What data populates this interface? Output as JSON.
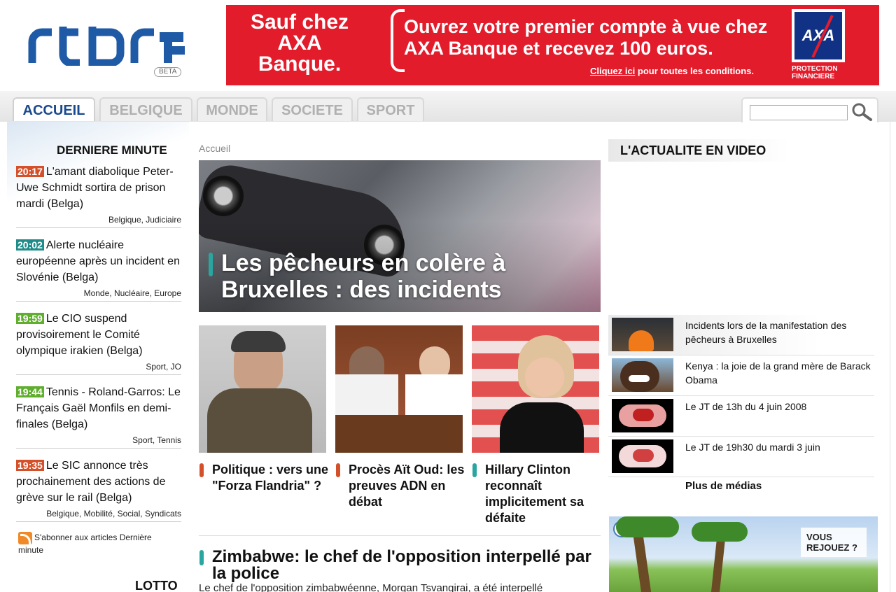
{
  "header": {
    "logo_text": "rtbf",
    "beta_label": "BETA"
  },
  "banner": {
    "left_text": "Sauf chez AXA Banque.",
    "main_text": "Ouvrez votre premier compte à vue chez AXA Banque et recevez 100 euros.",
    "cond_link": "Cliquez ici",
    "cond_rest": " pour toutes les conditions.",
    "brand": "AXA",
    "brand_sub": "PROTECTION FINANCIERE"
  },
  "nav": {
    "tabs": [
      {
        "label": "ACCUEIL",
        "active": true
      },
      {
        "label": "BELGIQUE",
        "active": false
      },
      {
        "label": "MONDE",
        "active": false
      },
      {
        "label": "SOCIETE",
        "active": false
      },
      {
        "label": "SPORT",
        "active": false
      }
    ],
    "search_placeholder": ""
  },
  "left": {
    "heading": "DERNIERE MINUTE",
    "items": [
      {
        "time": "20:17",
        "time_color": "#d4502a",
        "text": "L'amant diabolique Peter-Uwe Schmidt sortira de prison mardi (Belga)",
        "tags": "Belgique, Judiciaire"
      },
      {
        "time": "20:02",
        "time_color": "#1f8c8a",
        "text": "Alerte nucléaire européenne après un incident en Slovénie (Belga)",
        "tags": "Monde, Nucléaire, Europe"
      },
      {
        "time": "19:59",
        "time_color": "#5fae2e",
        "text": "Le CIO suspend provisoirement le Comité olympique irakien (Belga)",
        "tags": "Sport, JO"
      },
      {
        "time": "19:44",
        "time_color": "#5fae2e",
        "text": "Tennis - Roland-Garros: Le Français Gaël Monfils en demi-finales (Belga)",
        "tags": "Sport, Tennis"
      },
      {
        "time": "19:35",
        "time_color": "#d4502a",
        "text": "Le SIC annonce très prochainement des actions de grève sur le rail (Belga)",
        "tags": "Belgique, Mobilité, Social, Syndicats"
      }
    ],
    "rss_text": "S'abonner aux articles Dernière minute",
    "lotto_heading": "LOTTO"
  },
  "center": {
    "breadcrumb": "Accueil",
    "hero_title": "Les pêcheurs en colère à Bruxelles : des incidents",
    "stories": [
      {
        "title": "Politique : vers une \"Forza Flandria\" ?",
        "mark_color": "#d4502a"
      },
      {
        "title": "Procès Aït Oud: les preuves ADN en débat",
        "mark_color": "#d4502a"
      },
      {
        "title": "Hillary Clinton reconnaît implicitement sa défaite",
        "mark_color": "#2aa6a0"
      }
    ],
    "lead_title": "Zimbabwe: le chef de l'opposition interpellé par la police",
    "lead_text": "Le chef de l'opposition zimbabwéenne, Morgan Tsvangirai, a été interpellé"
  },
  "right": {
    "heading": "L'ACTUALITE EN VIDEO",
    "videos": [
      {
        "title": "Incidents lors de la manifestation des pêcheurs à Bruxelles"
      },
      {
        "title": "Kenya : la joie de la grand mère de Barack Obama"
      },
      {
        "title": "Le JT de 13h du 4 juin 2008"
      },
      {
        "title": "Le JT de 19h30 du mardi 3 juin"
      }
    ],
    "more_label": "Plus de médias",
    "promo_text": "VOUS REJOUEZ ?"
  },
  "colors": {
    "brand_blue": "#1a4a8e",
    "banner_red": "#e31c2c"
  }
}
